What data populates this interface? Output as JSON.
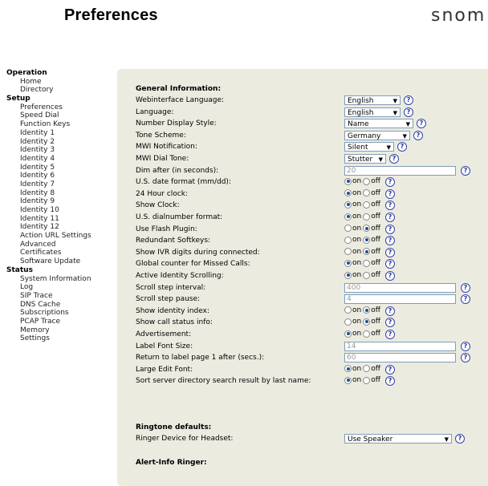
{
  "header": {
    "title": "Preferences",
    "logo": "snom"
  },
  "sidebar": {
    "groups": [
      {
        "label": "Operation",
        "items": [
          "Home",
          "Directory"
        ]
      },
      {
        "label": "Setup",
        "items": [
          "Preferences",
          "Speed Dial",
          "Function Keys",
          "Identity 1",
          "Identity 2",
          "Identity 3",
          "Identity 4",
          "Identity 5",
          "Identity 6",
          "Identity 7",
          "Identity 8",
          "Identity 9",
          "Identity 10",
          "Identity 11",
          "Identity 12",
          "Action URL Settings",
          "Advanced",
          "Certificates",
          "Software Update"
        ]
      },
      {
        "label": "Status",
        "items": [
          "System Information",
          "Log",
          "SIP Trace",
          "DNS Cache",
          "Subscriptions",
          "PCAP Trace",
          "Memory",
          "Settings"
        ]
      }
    ]
  },
  "sections": {
    "general": "General Information:",
    "ringtone": "Ringtone defaults:",
    "alert": "Alert-Info Ringer:"
  },
  "labels": {
    "on": "on",
    "off": "off",
    "help": "?"
  },
  "colors": {
    "panel": "#ecebe0",
    "radio_selected": "#1a4f9c",
    "help_icon": "#223399"
  },
  "settings": [
    {
      "label": "Webinterface Language:",
      "type": "select",
      "value": "English"
    },
    {
      "label": "Language:",
      "type": "select",
      "value": "English"
    },
    {
      "label": "Number Display Style:",
      "type": "select",
      "value": "Name"
    },
    {
      "label": "Tone Scheme:",
      "type": "select",
      "value": "Germany"
    },
    {
      "label": "MWI Notification:",
      "type": "select",
      "value": "Silent"
    },
    {
      "label": "MWI Dial Tone:",
      "type": "select",
      "value": "Stutter"
    },
    {
      "label": "Dim after (in seconds):",
      "type": "text",
      "value": "20"
    },
    {
      "label": "U.S. date format (mm/dd):",
      "type": "radio",
      "value": "on"
    },
    {
      "label": "24 Hour clock:",
      "type": "radio",
      "value": "on"
    },
    {
      "label": "Show Clock:",
      "type": "radio",
      "value": "on"
    },
    {
      "label": "U.S. dialnumber format:",
      "type": "radio",
      "value": "on"
    },
    {
      "label": "Use Flash Plugin:",
      "type": "radio",
      "value": "off"
    },
    {
      "label": "Redundant Softkeys:",
      "type": "radio",
      "value": "off"
    },
    {
      "label": "Show IVR digits during connected:",
      "type": "radio",
      "value": "off"
    },
    {
      "label": "Global counter for Missed Calls:",
      "type": "radio",
      "value": "on"
    },
    {
      "label": "Active Identity Scrolling:",
      "type": "radio",
      "value": "on"
    },
    {
      "label": "Scroll step interval:",
      "type": "text",
      "value": "400"
    },
    {
      "label": "Scroll step pause:",
      "type": "text",
      "value": "4"
    },
    {
      "label": "Show identity index:",
      "type": "radio",
      "value": "off"
    },
    {
      "label": "Show call status info:",
      "type": "radio",
      "value": "off"
    },
    {
      "label": "Advertisement:",
      "type": "radio",
      "value": "on"
    },
    {
      "label": "Label Font Size:",
      "type": "text",
      "value": "14"
    },
    {
      "label": "Return to label page 1 after (secs.):",
      "type": "text",
      "value": "60"
    },
    {
      "label": "Large Edit Font:",
      "type": "radio",
      "value": "on"
    },
    {
      "label": "Sort server directory search result by last name:",
      "type": "radio",
      "value": "on"
    }
  ],
  "ringtone": {
    "label": "Ringer Device for Headset:",
    "value": "Use Speaker"
  }
}
